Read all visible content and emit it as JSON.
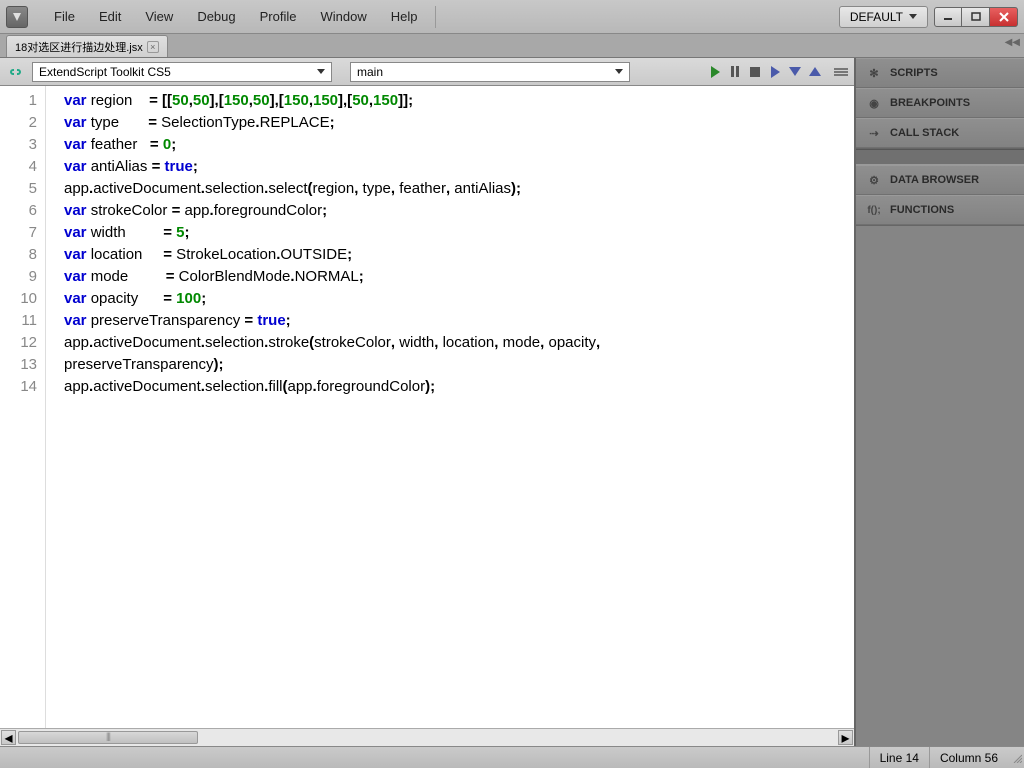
{
  "menu": {
    "file": "File",
    "edit": "Edit",
    "view": "View",
    "debug": "Debug",
    "profile": "Profile",
    "window": "Window",
    "help": "Help"
  },
  "workspace_label": "DEFAULT",
  "file_tab": "18对选区进行描边处理.jsx",
  "target_dropdown": "ExtendScript Toolkit CS5",
  "func_dropdown": "main",
  "side": {
    "scripts": "SCRIPTS",
    "breakpoints": "BREAKPOINTS",
    "callstack": "CALL STACK",
    "databrowser": "DATA BROWSER",
    "functions": "FUNCTIONS"
  },
  "status": {
    "line": "Line 14",
    "col": "Column 56"
  },
  "code_lines": [
    [
      [
        "kw",
        "var"
      ],
      [
        "plain",
        " region    "
      ],
      [
        "punct",
        "= [["
      ],
      [
        "num",
        "50"
      ],
      [
        "punct",
        ","
      ],
      [
        "num",
        "50"
      ],
      [
        "punct",
        "],["
      ],
      [
        "num",
        "150"
      ],
      [
        "punct",
        ","
      ],
      [
        "num",
        "50"
      ],
      [
        "punct",
        "],["
      ],
      [
        "num",
        "150"
      ],
      [
        "punct",
        ","
      ],
      [
        "num",
        "150"
      ],
      [
        "punct",
        "],["
      ],
      [
        "num",
        "50"
      ],
      [
        "punct",
        ","
      ],
      [
        "num",
        "150"
      ],
      [
        "punct",
        "]];"
      ]
    ],
    [
      [
        "kw",
        "var"
      ],
      [
        "plain",
        " type       "
      ],
      [
        "punct",
        "="
      ],
      [
        "plain",
        " SelectionType"
      ],
      [
        "punct",
        "."
      ],
      [
        "plain",
        "REPLACE"
      ],
      [
        "punct",
        ";"
      ]
    ],
    [
      [
        "kw",
        "var"
      ],
      [
        "plain",
        " feather   "
      ],
      [
        "punct",
        "="
      ],
      [
        "plain",
        " "
      ],
      [
        "num",
        "0"
      ],
      [
        "punct",
        ";"
      ]
    ],
    [
      [
        "kw",
        "var"
      ],
      [
        "plain",
        " antiAlias "
      ],
      [
        "punct",
        "="
      ],
      [
        "plain",
        " "
      ],
      [
        "kw",
        "true"
      ],
      [
        "punct",
        ";"
      ]
    ],
    [
      [
        "plain",
        "app"
      ],
      [
        "punct",
        "."
      ],
      [
        "plain",
        "activeDocument"
      ],
      [
        "punct",
        "."
      ],
      [
        "plain",
        "selection"
      ],
      [
        "punct",
        "."
      ],
      [
        "plain",
        "select"
      ],
      [
        "punct",
        "("
      ],
      [
        "plain",
        "region"
      ],
      [
        "punct",
        ","
      ],
      [
        "plain",
        " type"
      ],
      [
        "punct",
        ","
      ],
      [
        "plain",
        " feather"
      ],
      [
        "punct",
        ","
      ],
      [
        "plain",
        " antiAlias"
      ],
      [
        "punct",
        ");"
      ]
    ],
    [
      [
        "kw",
        "var"
      ],
      [
        "plain",
        " strokeColor "
      ],
      [
        "punct",
        "="
      ],
      [
        "plain",
        " app"
      ],
      [
        "punct",
        "."
      ],
      [
        "plain",
        "foregroundColor"
      ],
      [
        "punct",
        ";"
      ]
    ],
    [
      [
        "kw",
        "var"
      ],
      [
        "plain",
        " width         "
      ],
      [
        "punct",
        "="
      ],
      [
        "plain",
        " "
      ],
      [
        "num",
        "5"
      ],
      [
        "punct",
        ";"
      ]
    ],
    [
      [
        "kw",
        "var"
      ],
      [
        "plain",
        " location     "
      ],
      [
        "punct",
        "="
      ],
      [
        "plain",
        " StrokeLocation"
      ],
      [
        "punct",
        "."
      ],
      [
        "plain",
        "OUTSIDE"
      ],
      [
        "punct",
        ";"
      ]
    ],
    [
      [
        "kw",
        "var"
      ],
      [
        "plain",
        " mode         "
      ],
      [
        "punct",
        "="
      ],
      [
        "plain",
        " ColorBlendMode"
      ],
      [
        "punct",
        "."
      ],
      [
        "plain",
        "NORMAL"
      ],
      [
        "punct",
        ";"
      ]
    ],
    [
      [
        "kw",
        "var"
      ],
      [
        "plain",
        " opacity      "
      ],
      [
        "punct",
        "="
      ],
      [
        "plain",
        " "
      ],
      [
        "num",
        "100"
      ],
      [
        "punct",
        ";"
      ]
    ],
    [
      [
        "kw",
        "var"
      ],
      [
        "plain",
        " preserveTransparency "
      ],
      [
        "punct",
        "="
      ],
      [
        "plain",
        " "
      ],
      [
        "kw",
        "true"
      ],
      [
        "punct",
        ";"
      ]
    ],
    [
      [
        "plain",
        "app"
      ],
      [
        "punct",
        "."
      ],
      [
        "plain",
        "activeDocument"
      ],
      [
        "punct",
        "."
      ],
      [
        "plain",
        "selection"
      ],
      [
        "punct",
        "."
      ],
      [
        "plain",
        "stroke"
      ],
      [
        "punct",
        "("
      ],
      [
        "plain",
        "strokeColor"
      ],
      [
        "punct",
        ","
      ],
      [
        "plain",
        " width"
      ],
      [
        "punct",
        ","
      ],
      [
        "plain",
        " location"
      ],
      [
        "punct",
        ","
      ],
      [
        "plain",
        " mode"
      ],
      [
        "punct",
        ","
      ],
      [
        "plain",
        " opacity"
      ],
      [
        "punct",
        ","
      ]
    ],
    [
      [
        "plain",
        "preserveTransparency"
      ],
      [
        "punct",
        ");"
      ]
    ],
    [
      [
        "plain",
        "app"
      ],
      [
        "punct",
        "."
      ],
      [
        "plain",
        "activeDocument"
      ],
      [
        "punct",
        "."
      ],
      [
        "plain",
        "selection"
      ],
      [
        "punct",
        "."
      ],
      [
        "plain",
        "fill"
      ],
      [
        "punct",
        "("
      ],
      [
        "plain",
        "app"
      ],
      [
        "punct",
        "."
      ],
      [
        "plain",
        "foregroundColor"
      ],
      [
        "punct",
        ");"
      ]
    ]
  ],
  "line_count": 14
}
